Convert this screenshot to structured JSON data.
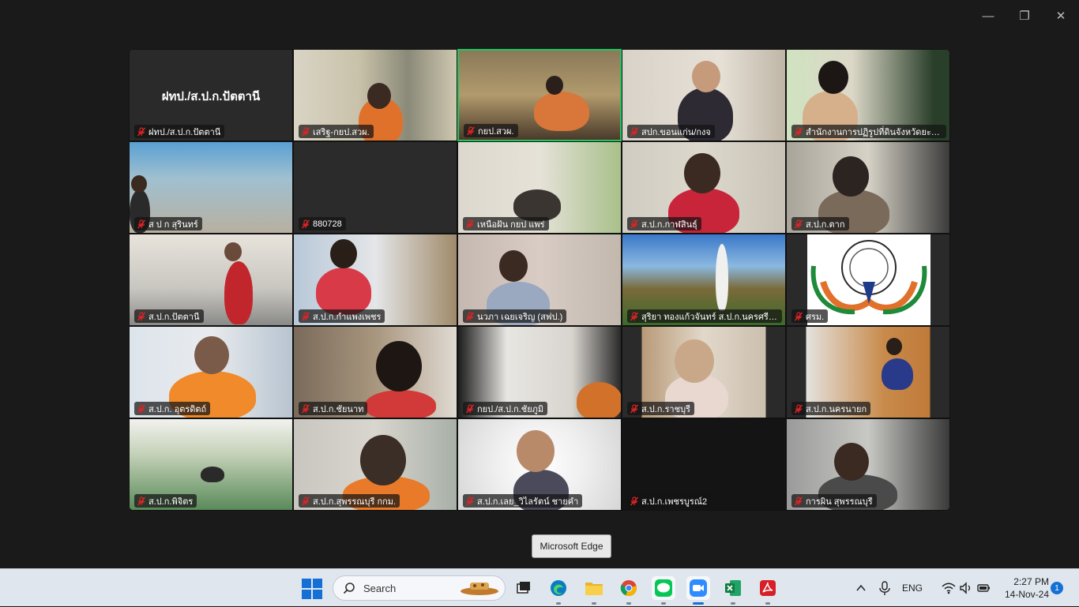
{
  "window": {
    "controls": {
      "minimize": "—",
      "maximize": "❐",
      "close": "✕"
    }
  },
  "tiles": [
    {
      "name": "ฝทป./ส.ป.ก.ปัตตานี",
      "big": "ฝทป./ส.ป.ก.ปัตตานี"
    },
    {
      "name": "เสริฐ-กยป.สวผ."
    },
    {
      "name": "กยป.สวผ."
    },
    {
      "name": "สปก.ขอนแก่น/กงจ"
    },
    {
      "name": "สำนักงานการปฏิรูปที่ดินจังหวัดยะลา..."
    },
    {
      "name": "ส ป ก สุรินทร์"
    },
    {
      "name": "880728"
    },
    {
      "name": "เหนือฝัน กยป แพร่"
    },
    {
      "name": "ส.ป.ก.กาฬสินธุ์"
    },
    {
      "name": "ส.ป.ก.ตาก"
    },
    {
      "name": "ส.ป.ก.ปัตตานี"
    },
    {
      "name": "ส.ป.ก.กำแพงเพชร"
    },
    {
      "name": "นวภา เฉยเจริญ (สฟป.)"
    },
    {
      "name": "สุริยา ทองแก้วจันทร์ ส.ป.ก.นครศรีธ..."
    },
    {
      "name": "ศรม."
    },
    {
      "name": "ส.ป.ก. อุตรดิตถ์"
    },
    {
      "name": "ส.ป.ก.ชัยนาท"
    },
    {
      "name": "กยป./ส.ป.ก.ชัยภูมิ"
    },
    {
      "name": "ส.ป.ก.ราชบุรี"
    },
    {
      "name": "ส.ป.ก.นครนายก"
    },
    {
      "name": "ส.ป.ก.พิจิตร"
    },
    {
      "name": "ส.ป.ก.สุพรรณบุรี กกม."
    },
    {
      "name": "ส.ป.ก.เลย_วิไลรัตน์ ชายคำ"
    },
    {
      "name": "ส.ป.ก.เพชรบูรณ์2"
    },
    {
      "name": "การผิน สุพรรณบุรี"
    }
  ],
  "tooltip": "Microsoft Edge",
  "taskbar": {
    "search_placeholder": "Search",
    "apps": [
      "file-explorer",
      "edge",
      "file-manager",
      "chrome",
      "line",
      "zoom",
      "excel",
      "acrobat"
    ],
    "lang": "ENG",
    "time": "2:27 PM",
    "date": "14-Nov-24",
    "notifications": "1"
  },
  "colors": {
    "active_speaker": "#22c55e",
    "muted_mic": "#e02424",
    "accent": "#1570d6"
  }
}
